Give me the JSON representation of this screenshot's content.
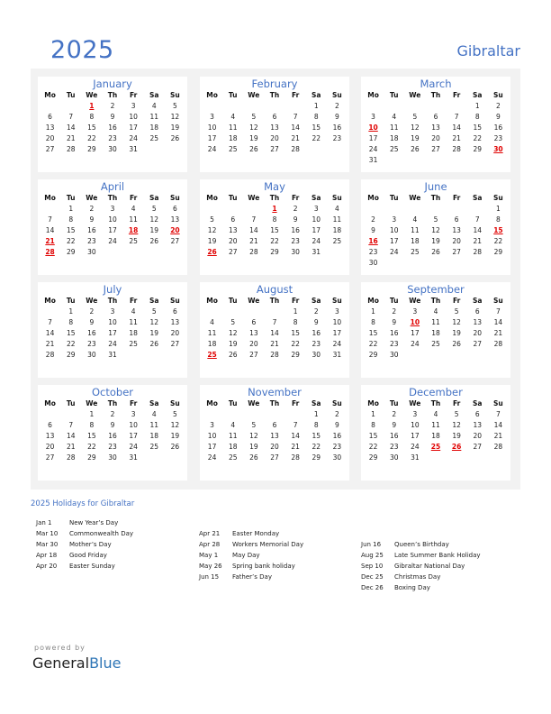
{
  "header": {
    "year": "2025",
    "country": "Gibraltar"
  },
  "weekdays": [
    "Mo",
    "Tu",
    "We",
    "Th",
    "Fr",
    "Sa",
    "Su"
  ],
  "months": [
    {
      "name": "January",
      "offset": 2,
      "days": 31,
      "holidays": [
        1
      ]
    },
    {
      "name": "February",
      "offset": 5,
      "days": 28,
      "holidays": []
    },
    {
      "name": "March",
      "offset": 5,
      "days": 31,
      "holidays": [
        10,
        30
      ]
    },
    {
      "name": "April",
      "offset": 1,
      "days": 30,
      "holidays": [
        18,
        20,
        21,
        28
      ]
    },
    {
      "name": "May",
      "offset": 3,
      "days": 31,
      "holidays": [
        1,
        26
      ]
    },
    {
      "name": "June",
      "offset": 6,
      "days": 30,
      "holidays": [
        15,
        16
      ]
    },
    {
      "name": "July",
      "offset": 1,
      "days": 31,
      "holidays": []
    },
    {
      "name": "August",
      "offset": 4,
      "days": 31,
      "holidays": [
        25
      ]
    },
    {
      "name": "September",
      "offset": 0,
      "days": 30,
      "holidays": [
        10
      ]
    },
    {
      "name": "October",
      "offset": 2,
      "days": 31,
      "holidays": []
    },
    {
      "name": "November",
      "offset": 5,
      "days": 30,
      "holidays": []
    },
    {
      "name": "December",
      "offset": 0,
      "days": 31,
      "holidays": [
        25,
        26
      ]
    }
  ],
  "holidays_section": {
    "title": "2025 Holidays for Gibraltar",
    "columns": [
      [
        {
          "date": "Jan 1",
          "name": "New Year’s Day"
        },
        {
          "date": "Mar 10",
          "name": "Commonwealth Day"
        },
        {
          "date": "Mar 30",
          "name": "Mother’s Day"
        },
        {
          "date": "Apr 18",
          "name": "Good Friday"
        },
        {
          "date": "Apr 20",
          "name": "Easter Sunday"
        }
      ],
      [
        {
          "date": "Apr 21",
          "name": "Easter Monday"
        },
        {
          "date": "Apr 28",
          "name": "Workers Memorial Day"
        },
        {
          "date": "May 1",
          "name": "May Day"
        },
        {
          "date": "May 26",
          "name": "Spring bank holiday"
        },
        {
          "date": "Jun 15",
          "name": "Father’s Day"
        }
      ],
      [
        {
          "date": "Jun 16",
          "name": "Queen’s Birthday"
        },
        {
          "date": "Aug 25",
          "name": "Late Summer Bank Holiday"
        },
        {
          "date": "Sep 10",
          "name": "Gibraltar National Day"
        },
        {
          "date": "Dec 25",
          "name": "Christmas Day"
        },
        {
          "date": "Dec 26",
          "name": "Boxing Day"
        }
      ]
    ]
  },
  "footer": {
    "powered_by": "powered by",
    "brand_general": "General",
    "brand_blue": "Blue"
  },
  "colors": {
    "accent": "#4472c4",
    "holiday": "#e00000",
    "panel": "#f2f2f2"
  }
}
